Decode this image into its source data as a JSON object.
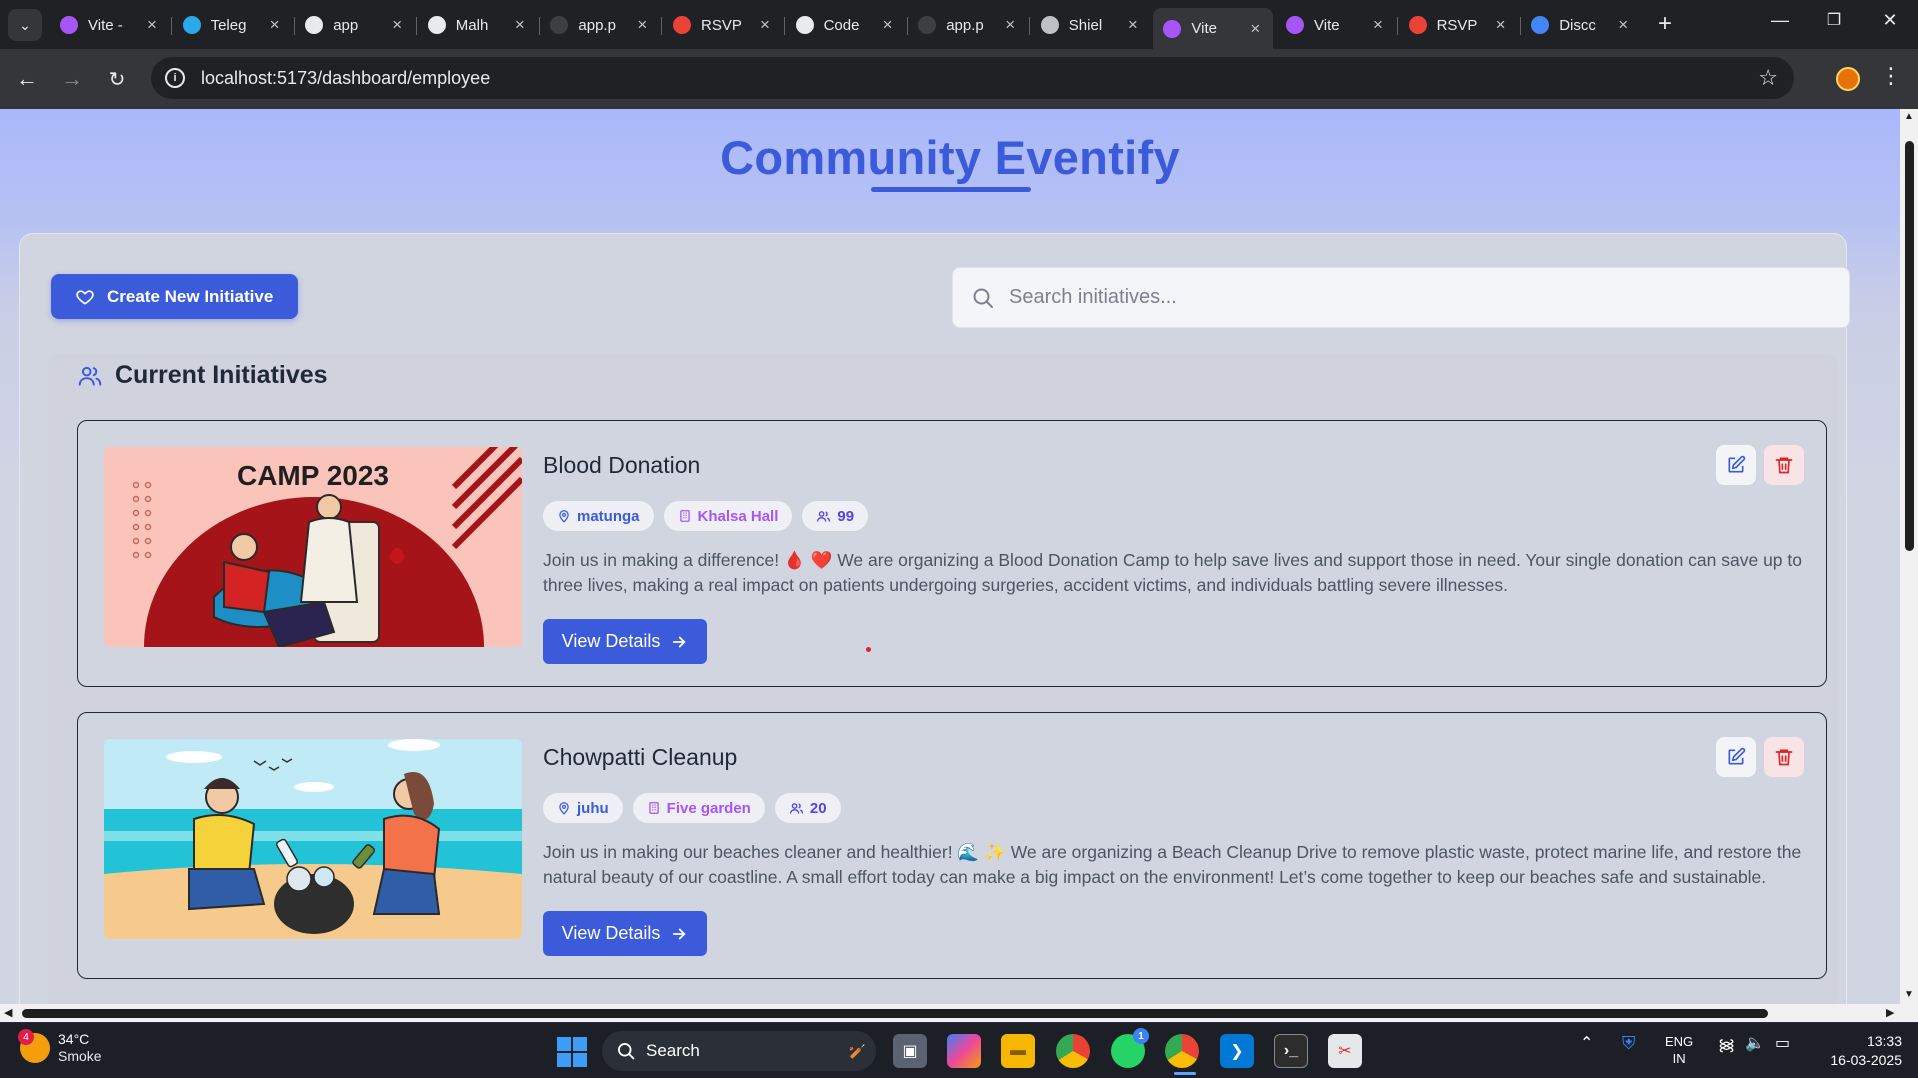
{
  "browser": {
    "tabs": [
      {
        "label": "Vite -",
        "fav": "vite-icon",
        "color": "#a855f7"
      },
      {
        "label": "Teleg",
        "fav": "telegram-icon",
        "color": "#29a9eb"
      },
      {
        "label": "app",
        "fav": "crown-icon",
        "color": "#e8eaed"
      },
      {
        "label": "Malh",
        "fav": "github-icon",
        "color": "#e8eaed"
      },
      {
        "label": "app.p",
        "fav": "github-icon",
        "color": "#3c4043"
      },
      {
        "label": "RSVP",
        "fav": "gmail-icon",
        "color": "#ea4335"
      },
      {
        "label": "Code",
        "fav": "github-icon",
        "color": "#e8eaed"
      },
      {
        "label": "app.p",
        "fav": "github-icon",
        "color": "#3c4043"
      },
      {
        "label": "Shiel",
        "fav": "globe-icon",
        "color": "#bdc1c6"
      },
      {
        "label": "Vite",
        "fav": "vite-icon",
        "color": "#a855f7"
      },
      {
        "label": "Vite",
        "fav": "vite-icon",
        "color": "#a855f7"
      },
      {
        "label": "RSVP",
        "fav": "gmail-icon",
        "color": "#ea4335"
      },
      {
        "label": "Discc",
        "fav": "docs-icon",
        "color": "#4285f4"
      }
    ],
    "active_tab": 9,
    "url": "localhost:5173/dashboard/employee"
  },
  "page": {
    "brand": "Community Eventify",
    "create_button": "Create New Initiative",
    "search_placeholder": "Search initiatives...",
    "section_title": "Current Initiatives",
    "view_details_label": "View Details",
    "initiatives": [
      {
        "title": "Blood Donation",
        "location": "matunga",
        "venue": "Khalsa Hall",
        "attendees": "99",
        "image_caption": "CAMP 2023",
        "description": "Join us in making a difference! 🩸 ❤️ We are organizing a Blood Donation Camp to help save lives and support those in need. Your single donation can save up to three lives, making a real impact on patients undergoing surgeries, accident victims, and individuals battling severe illnesses."
      },
      {
        "title": "Chowpatti Cleanup",
        "location": "juhu",
        "venue": "Five garden",
        "attendees": "20",
        "description": "Join us in making our beaches cleaner and healthier! 🌊 ✨ We are organizing a Beach Cleanup Drive to remove plastic waste, protect marine life, and restore the natural beauty of our coastline. A small effort today can make a big impact on the environment! Let’s come together to keep our beaches safe and sustainable."
      }
    ],
    "colors": {
      "accent": "#3b5bdb",
      "danger": "#dc2626",
      "venue": "#a855f7"
    }
  },
  "taskbar": {
    "weather_temp": "34°C",
    "weather_desc": "Smoke",
    "weather_badge": "4",
    "search_label": "Search",
    "whatsapp_badge": "1",
    "lang_line1": "ENG",
    "lang_line2": "IN",
    "time": "13:33",
    "date": "16-03-2025"
  }
}
